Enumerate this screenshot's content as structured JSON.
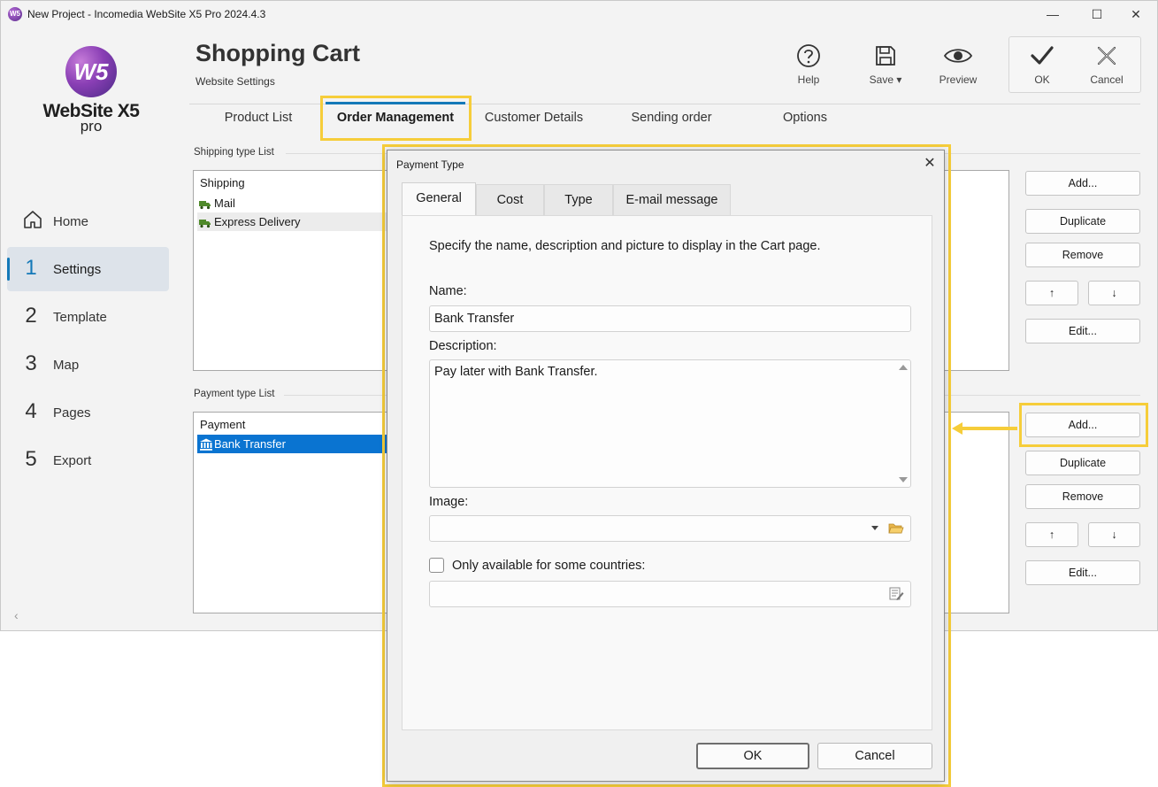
{
  "window": {
    "title": "New Project - Incomedia WebSite X5 Pro 2024.4.3",
    "controls": {
      "minimize": "—",
      "maximize": "☐",
      "close": "✕"
    }
  },
  "logo": {
    "mark": "W5",
    "name": "WebSite X5",
    "edition": "pro"
  },
  "nav": [
    {
      "num": "",
      "label": "Home",
      "icon": "home-icon"
    },
    {
      "num": "1",
      "label": "Settings",
      "active": true
    },
    {
      "num": "2",
      "label": "Template"
    },
    {
      "num": "3",
      "label": "Map"
    },
    {
      "num": "4",
      "label": "Pages"
    },
    {
      "num": "5",
      "label": "Export"
    }
  ],
  "collapse": "‹",
  "header": {
    "title": "Shopping Cart",
    "subtitle": "Website Settings"
  },
  "toolbar": {
    "help": "Help",
    "save": "Save ▾",
    "preview": "Preview",
    "ok": "OK",
    "cancel": "Cancel"
  },
  "tabs": [
    "Product List",
    "Order Management",
    "Customer Details",
    "Sending order",
    "Options"
  ],
  "shipping": {
    "section": "Shipping type List",
    "header": "Shipping",
    "rows": [
      "Mail",
      "Express Delivery"
    ]
  },
  "payment": {
    "section": "Payment type List",
    "header": "Payment",
    "rows": [
      "Bank Transfer"
    ]
  },
  "side_buttons": {
    "add": "Add...",
    "duplicate": "Duplicate",
    "remove": "Remove",
    "up": "↑",
    "down": "↓",
    "edit": "Edit..."
  },
  "dialog": {
    "title": "Payment Type",
    "close": "✕",
    "tabs": [
      "General",
      "Cost",
      "Type",
      "E-mail message"
    ],
    "intro": "Specify the name, description and picture to display in the Cart page.",
    "name_label": "Name:",
    "name_value": "Bank Transfer",
    "description_label": "Description:",
    "description_value": "Pay later with Bank Transfer.",
    "image_label": "Image:",
    "image_value": "",
    "countries_label": "Only available for some countries:",
    "countries_checked": false,
    "countries_value": "",
    "ok": "OK",
    "cancel": "Cancel"
  },
  "colors": {
    "accent": "#1479b8",
    "highlight": "#f6cd3a",
    "selection": "#0a74d1"
  }
}
